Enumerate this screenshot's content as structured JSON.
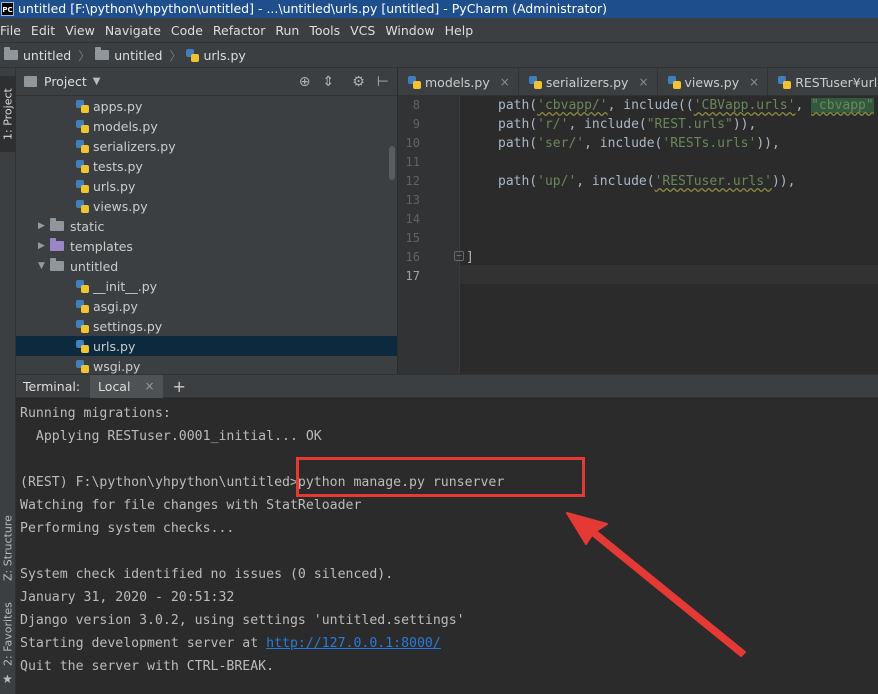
{
  "window": {
    "app_icon": "PC",
    "title": "untitled [F:\\python\\yhpython\\untitled] - ...\\untitled\\urls.py [untitled] - PyCharm (Administrator)"
  },
  "menu": [
    "File",
    "Edit",
    "View",
    "Navigate",
    "Code",
    "Refactor",
    "Run",
    "Tools",
    "VCS",
    "Window",
    "Help"
  ],
  "breadcrumb": [
    "untitled",
    "untitled",
    "urls.py"
  ],
  "left_strip": {
    "project_tab": "1: Project",
    "structure_tab": "Z: Structure",
    "favorites_tab": "2: Favorites"
  },
  "project_panel": {
    "title": "Project",
    "items": [
      {
        "label": "apps.py",
        "type": "py"
      },
      {
        "label": "models.py",
        "type": "py"
      },
      {
        "label": "serializers.py",
        "type": "py"
      },
      {
        "label": "tests.py",
        "type": "py"
      },
      {
        "label": "urls.py",
        "type": "py"
      },
      {
        "label": "views.py",
        "type": "py"
      },
      {
        "label": "static",
        "type": "folder"
      },
      {
        "label": "templates",
        "type": "folder"
      },
      {
        "label": "untitled",
        "type": "folder"
      },
      {
        "label": "__init__.py",
        "type": "py"
      },
      {
        "label": "asgi.py",
        "type": "py"
      },
      {
        "label": "settings.py",
        "type": "py"
      },
      {
        "label": "urls.py",
        "type": "py",
        "selected": true
      },
      {
        "label": "wsgi.py",
        "type": "py"
      }
    ]
  },
  "editor_tabs": [
    "models.py",
    "serializers.py",
    "views.py",
    "RESTuser¥urls.py"
  ],
  "editor": {
    "line_numbers": [
      "8",
      "9",
      "10",
      "11",
      "12",
      "13",
      "14",
      "15",
      "16",
      "17"
    ],
    "lines": {
      "l8_a": "path(",
      "l8_s1": "'cbvapp/'",
      "l8_b": ", include((",
      "l8_s2": "'CBVapp.urls'",
      "l8_c": ", ",
      "l8_s3": "\"cbvapp\"",
      "l9_a": "path(",
      "l9_s1": "'r/'",
      "l9_b": ", include(",
      "l9_s2": "\"REST.urls\"",
      "l9_c": ")),",
      "l10_a": "path(",
      "l10_s1": "'ser/'",
      "l10_b": ", include(",
      "l10_s2": "'RESTs.urls'",
      "l10_c": ")),",
      "l12_a": "path(",
      "l12_s1": "'up/'",
      "l12_b": ", include(",
      "l12_s2": "'RESTuser.urls'",
      "l12_c": ")),",
      "l16": "]"
    }
  },
  "terminal": {
    "label": "Terminal:",
    "tab": "Local",
    "lines": [
      "Running migrations:",
      "  Applying RESTuser.0001_initial... OK",
      "",
      "(REST) F:\\python\\yhpython\\untitled>python manage.py runserver",
      "Watching for file changes with StatReloader",
      "Performing system checks...",
      "",
      "System check identified no issues (0 silenced).",
      "January 31, 2020 - 20:51:32",
      "Django version 3.0.2, using settings 'untitled.settings'"
    ],
    "server_prefix": "Starting development server at ",
    "server_url": "http://127.0.0.1:8000/",
    "quit_line": "Quit the server with CTRL-BREAK."
  },
  "colors": {
    "annotation": "#e53935",
    "link": "#287bde",
    "title_bar": "#1e4f8c"
  }
}
